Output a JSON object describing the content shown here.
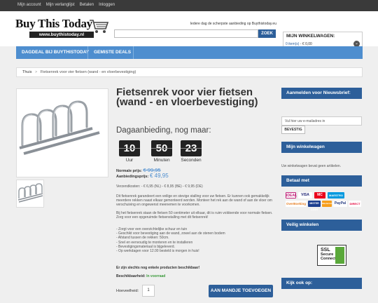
{
  "topbar": {
    "links": [
      "Mijn account",
      "Mijn verlanglijst",
      "Betalen",
      "Inloggen"
    ]
  },
  "header": {
    "logo_text": "Buy This Today",
    "logo_url_text": "www.buythistoday.nl",
    "tagline": "Iedere dag de scherpste aanbieding op Buythistoday.eu",
    "search_placeholder": "",
    "search_button": "ZOEK",
    "cart_title": "MIJN WINKELWAGEN:",
    "cart_items": "0 item(s)",
    "cart_total": "- € 0,00"
  },
  "nav": {
    "items": [
      "DAGDEAL BIJ BUYTHISTODAY",
      "GEMISTE DEALS"
    ]
  },
  "breadcrumb": {
    "home": "Thuis",
    "separator": ">",
    "current": "Fietsenrek voor vier fietsen (wand - en vloerbevestiging)"
  },
  "product": {
    "title": "Fietsenrek voor vier fietsen (wand - en vloerbevestiging)",
    "deal_label": "Dagaanbieding, nog maar:",
    "timer": [
      {
        "value": "10",
        "label": "Uur"
      },
      {
        "value": "50",
        "label": "Minuten"
      },
      {
        "value": "23",
        "label": "Seconden"
      }
    ],
    "normal_price_label": "Normale prijs:",
    "normal_price": "€ 99,95",
    "offer_price_label": "Aanbiedingsprijs:",
    "offer_price": "€ 49,95",
    "shipping": "Verzendkosten: - € 6,95 (NL) - € 8,95 (BE) - € 9,95 (DE)",
    "description": [
      "Dit fietsenrek garandeert een veilige en stevige stalling voor uw fietsen. Er kunnen ook gemakkelijk meerdere rekken naast elkaar gemonteerd worden. Monteer het rek aan de wand of aan de vloer om verschuiving en ongewenst meenemen te voorkomen.",
      "Bij het fietsenrek staan de fietsen 50 centimeter uit elkaar, dit is ruim voldoende voor normale fietsen. Zorg voor een opgeruimde fietsenstalling met dit fietsenrek!"
    ],
    "bullets": [
      "- Zorgt voor een overzichtelijke schuur en tuin",
      "- Geschikt voor bevestiging aan de wand, zowel aan de stenen bodem",
      "- Afstand tussen de rekken: 50cm.",
      "- Snel en eenvoudig te monteren en te installeren",
      "- Bevestigingsmateriaal is bijgeleverd.",
      "- Op werkdagen voor 12.00 besteld is morgen in huis!"
    ],
    "only_few": "Er zijn slechts nog enkele producten beschikbaar!",
    "availability_label": "Beschikbaarheid:",
    "availability_value": "In voorraad",
    "qty_label": "Hoeveelheid:",
    "qty_value": "1",
    "add_to_cart": "AAN MANDJE TOEVOEGEN"
  },
  "sidebar": {
    "newsletter_title": "Aanmelden voor Nieuwsbrief:",
    "newsletter_placeholder": "Vul hier uw e-mailadres in",
    "newsletter_button": "BEVESTIG",
    "cart_title": "Mijn winkelwagen",
    "cart_empty": "Uw winkelwagen bevat geen artikelen.",
    "pay_title": "Betaal met",
    "pay_logos": [
      "iDEAL",
      "VISA",
      "MC",
      "MAESTRO",
      "OverBoeking",
      "MISTER CASH",
      "Mastercard",
      "PayPal",
      "afterpay",
      "DIRECT"
    ],
    "safe_title": "Veilig winkelen",
    "ssl_text": [
      "SSL",
      "Secure",
      "Connection"
    ],
    "also_title": "Kijk ook op:"
  },
  "colors": {
    "brand_blue": "#2d5f9a",
    "nav_blue": "#4e8ecf",
    "topbar": "#3a3a3a",
    "stock_green": "#3a9a3a"
  }
}
